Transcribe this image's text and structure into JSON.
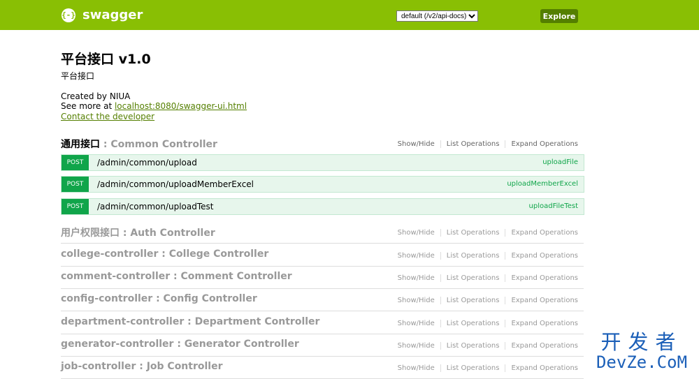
{
  "header": {
    "logo_glyph": "{-}",
    "logo_text": "swagger",
    "spec_selected": "default (/v2/api-docs)",
    "explore_label": "Explore"
  },
  "info": {
    "title": "平台接口 v1.0",
    "subtitle": "平台接口",
    "created_by": "Created by NIUA",
    "see_more_prefix": "See more at ",
    "see_more_link": "localhost:8080/swagger-ui.html",
    "contact": "Contact the developer"
  },
  "ops_labels": {
    "show_hide": "Show/Hide",
    "list": "List Operations",
    "expand": "Expand Operations"
  },
  "resources": [
    {
      "cn": "通用接口",
      "name": " : Common Controller",
      "active": true
    },
    {
      "cn": "用户权限接口",
      "name": " : Auth Controller"
    },
    {
      "cn": "",
      "name": "college-controller : College Controller"
    },
    {
      "cn": "",
      "name": "comment-controller : Comment Controller"
    },
    {
      "cn": "",
      "name": "config-controller : Config Controller"
    },
    {
      "cn": "",
      "name": "department-controller : Department Controller"
    },
    {
      "cn": "",
      "name": "generator-controller : Generator Controller"
    },
    {
      "cn": "",
      "name": "job-controller : Job Controller"
    }
  ],
  "endpoints": [
    {
      "method": "POST",
      "path": "/admin/common/upload",
      "nickname": "uploadFile"
    },
    {
      "method": "POST",
      "path": "/admin/common/uploadMemberExcel",
      "nickname": "uploadMemberExcel"
    },
    {
      "method": "POST",
      "path": "/admin/common/uploadTest",
      "nickname": "uploadFileTest"
    }
  ],
  "watermark": {
    "cn": "开发者",
    "en": "DevZe.CoM"
  },
  "colors": {
    "brand": "#89bf04",
    "explore": "#547f00",
    "post": "#10a54a",
    "post_bg": "#e7f6ec"
  }
}
